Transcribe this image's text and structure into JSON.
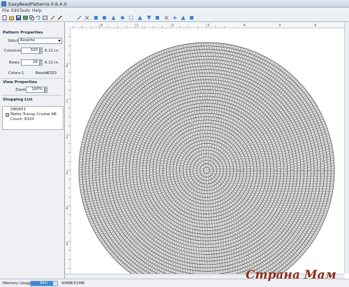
{
  "window": {
    "title": "EasyBeadPatterns 0.6.4.0"
  },
  "menu": [
    "File",
    "Edit",
    "Tools",
    "Help"
  ],
  "toolbar_icons": [
    "new-icon",
    "open-icon",
    "save-icon",
    "export-icon",
    "copy-icon",
    "undo-icon",
    "redo-icon",
    "pencil-icon",
    "eyedropper-icon",
    "line-icon",
    "fill-icon",
    "rectangle-icon",
    "circle-icon",
    "triangle-icon",
    "diamond-icon",
    "select-icon",
    "zoom-in-icon",
    "zoom-out-icon",
    "grid-icon",
    "flip-icon",
    "rotate-icon",
    "text-icon",
    "settings-icon"
  ],
  "pattern_properties": {
    "heading": "Pattern Properties",
    "stitch_label": "Stitch:",
    "stitch_value": "Rosette",
    "columns_label": "Columns:",
    "columns_value": "320",
    "columns_size": "6.11 in.",
    "rows_label": "Rows:",
    "rows_value": "26",
    "rows_size": "6.11 in.",
    "colors_label": "Colors:",
    "colors_value": "1",
    "beads_label": "Beads:",
    "beads_value": "8320"
  },
  "view_properties": {
    "heading": "View Properties",
    "zoom_label": "Zoom:",
    "zoom_value": "100%"
  },
  "shopping_list": {
    "heading": "Shopping List",
    "items": [
      {
        "code": "DB0651",
        "name": "Matte Transp Crystal AB",
        "count": "Count: 8320",
        "color": "#c9c9c9"
      }
    ]
  },
  "ruler": {
    "top_ticks": [
      "0",
      "1",
      "2",
      "3",
      "4",
      "5",
      "6"
    ],
    "left_ticks": [
      "0",
      "1",
      "2",
      "3",
      "4",
      "5"
    ]
  },
  "status": {
    "memory_label": "Memory Usage:",
    "memory_percent": "84%",
    "memory_fraction": 0.84,
    "memory_text": "43MB/51MB"
  },
  "pattern": {
    "rings": 38,
    "bead_color": "#b9b9b9",
    "bead_outline": "#555555"
  },
  "watermark": "Страна Мам"
}
